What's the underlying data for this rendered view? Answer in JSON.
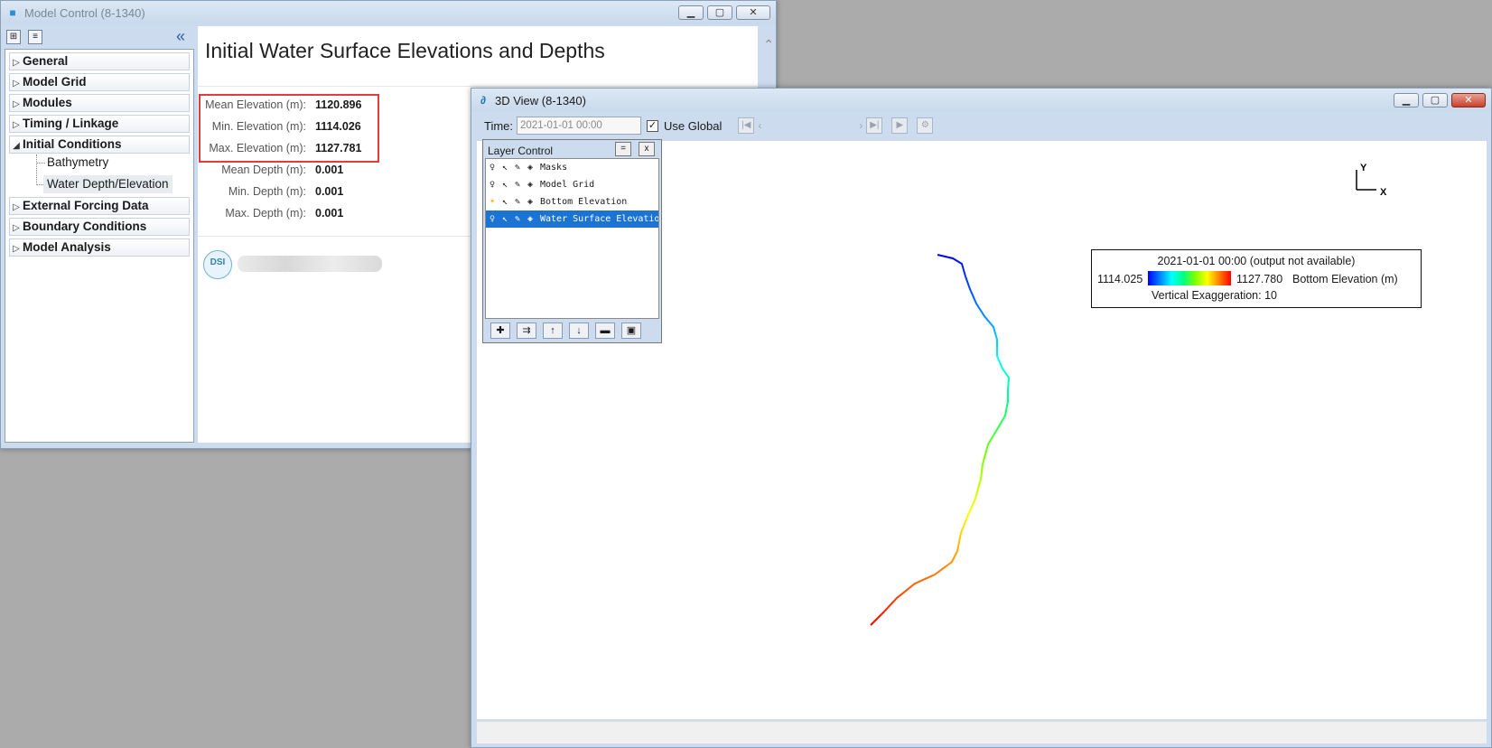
{
  "model_control": {
    "title": "Model Control (8-1340)",
    "tree": [
      {
        "label": "General",
        "expanded": false
      },
      {
        "label": "Model Grid",
        "expanded": false
      },
      {
        "label": "Modules",
        "expanded": false
      },
      {
        "label": "Timing / Linkage",
        "expanded": false
      },
      {
        "label": "Initial Conditions",
        "expanded": true,
        "children": [
          "Bathymetry",
          "Water Depth/Elevation"
        ]
      },
      {
        "label": "External Forcing Data",
        "expanded": false
      },
      {
        "label": "Boundary Conditions",
        "expanded": false
      },
      {
        "label": "Model Analysis",
        "expanded": false
      }
    ],
    "selected_child": "Water Depth/Elevation",
    "heading": "Initial Water Surface Elevations and Depths",
    "stats": [
      {
        "label": "Mean Elevation (m):",
        "value": "1120.896"
      },
      {
        "label": "Min. Elevation (m):",
        "value": "1114.026"
      },
      {
        "label": "Max. Elevation (m):",
        "value": "1127.781"
      },
      {
        "label": "Mean Depth (m):",
        "value": "0.001"
      },
      {
        "label": "Min. Depth (m):",
        "value": "0.001"
      },
      {
        "label": "Max. Depth (m):",
        "value": "0.001"
      }
    ],
    "logo_text": "DSI"
  },
  "view3d": {
    "title": "3D View (8-1340)",
    "time_label": "Time:",
    "time_value": "2021-01-01 00:00",
    "use_global_label": "Use Global",
    "use_global_checked": true,
    "layer_control": {
      "title": "Layer Control",
      "pin_btn": "=",
      "close_btn": "x",
      "layers": [
        {
          "name": "Masks",
          "selected": false,
          "visible": false
        },
        {
          "name": "Model Grid",
          "selected": false,
          "visible": false
        },
        {
          "name": "Bottom Elevation",
          "selected": false,
          "visible": true
        },
        {
          "name": "Water Surface Elevation",
          "selected": true,
          "visible": false
        }
      ]
    },
    "axis": {
      "y": "Y",
      "x": "X"
    },
    "legend": {
      "title": "2021-01-01 00:00 (output not available)",
      "min": "1114.025",
      "max": "1127.780",
      "variable": "Bottom Elevation (m)",
      "exaggeration": "Vertical Exaggeration: 10"
    }
  },
  "colors": {
    "accent": "#1b73d3",
    "highlight_border": "#e43b3b",
    "titlebar": "#dce8f5"
  }
}
